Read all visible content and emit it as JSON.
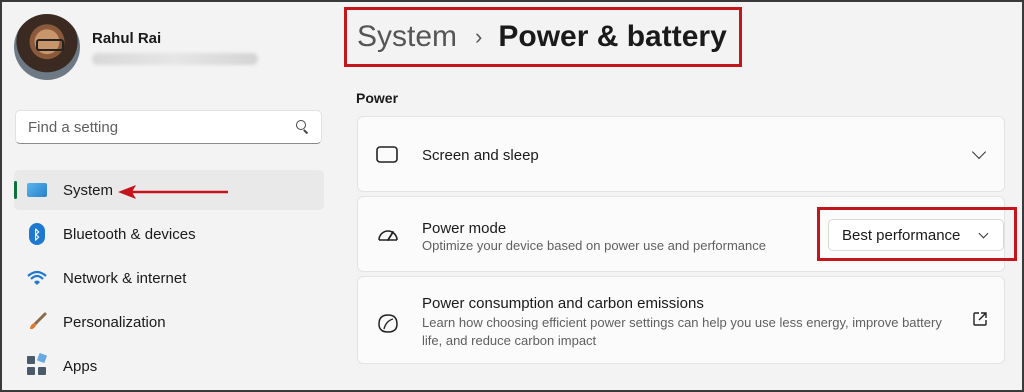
{
  "profile": {
    "name": "Rahul Rai"
  },
  "search": {
    "placeholder": "Find a setting"
  },
  "sidebar": {
    "items": [
      {
        "label": "System",
        "icon": "system-icon",
        "active": true
      },
      {
        "label": "Bluetooth & devices",
        "icon": "bluetooth-icon"
      },
      {
        "label": "Network & internet",
        "icon": "wifi-icon"
      },
      {
        "label": "Personalization",
        "icon": "brush-icon"
      },
      {
        "label": "Apps",
        "icon": "apps-icon"
      }
    ]
  },
  "header": {
    "parent": "System",
    "separator": "›",
    "title": "Power & battery"
  },
  "main": {
    "section_label": "Power",
    "cards": [
      {
        "title": "Screen and sleep",
        "icon": "screen-sleep-icon"
      },
      {
        "title": "Power mode",
        "description": "Optimize your device based on power use and performance",
        "icon": "power-mode-icon",
        "selected_value": "Best performance"
      },
      {
        "title": "Power consumption and carbon emissions",
        "description": "Learn how choosing efficient power settings can help you use less energy, improve battery life, and reduce carbon impact",
        "icon": "leaf-icon"
      }
    ]
  },
  "colors": {
    "highlight": "#c4141c",
    "active_indicator": "#0f6e3c",
    "background": "#f3f3f3"
  }
}
